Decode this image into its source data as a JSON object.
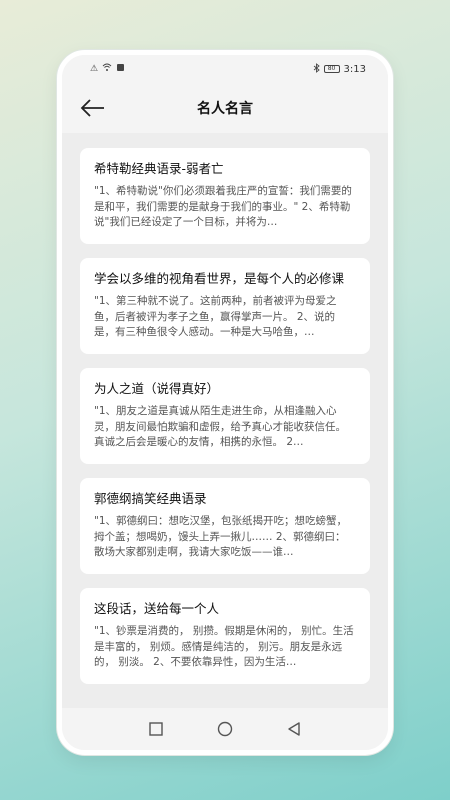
{
  "status": {
    "time": "3:13",
    "battery": "80"
  },
  "header": {
    "title": "名人名言"
  },
  "cards": [
    {
      "title": "希特勒经典语录-弱者亡",
      "body": "\"1、希特勒说\"你们必须跟着我庄严的宣誓：我们需要的是和平，我们需要的是献身于我们的事业。\" 2、希特勒说\"我们已经设定了一个目标，并将为…"
    },
    {
      "title": "学会以多维的视角看世界，是每个人的必修课",
      "body": "\"1、第三种就不说了。这前两种，前者被评为母爱之鱼，后者被评为孝子之鱼，赢得掌声一片。 2、说的是，有三种鱼很令人感动。一种是大马哈鱼，…"
    },
    {
      "title": "为人之道（说得真好）",
      "body": "\"1、朋友之道是真诚从陌生走进生命，从相逢融入心灵，朋友间最怕欺骗和虚假，给予真心才能收获信任。真诚之后会是暖心的友情，相携的永恒。 2…"
    },
    {
      "title": "郭德纲搞笑经典语录",
      "body": "\"1、郭德纲曰：想吃汉堡，包张纸揭开吃；想吃螃蟹，拇个盖；想喝奶，馒头上弄一揪儿…… 2、郭德纲曰：散场大家都别走啊，我请大家吃饭——谁…"
    },
    {
      "title": "这段话，送给每一个人",
      "body": "\"1、钞票是消费的， 别攒。假期是休闲的， 别忙。生活是丰富的， 别烦。感情是纯洁的， 别污。朋友是永远的， 别淡。 2、不要依靠异性，因为生活…"
    }
  ]
}
